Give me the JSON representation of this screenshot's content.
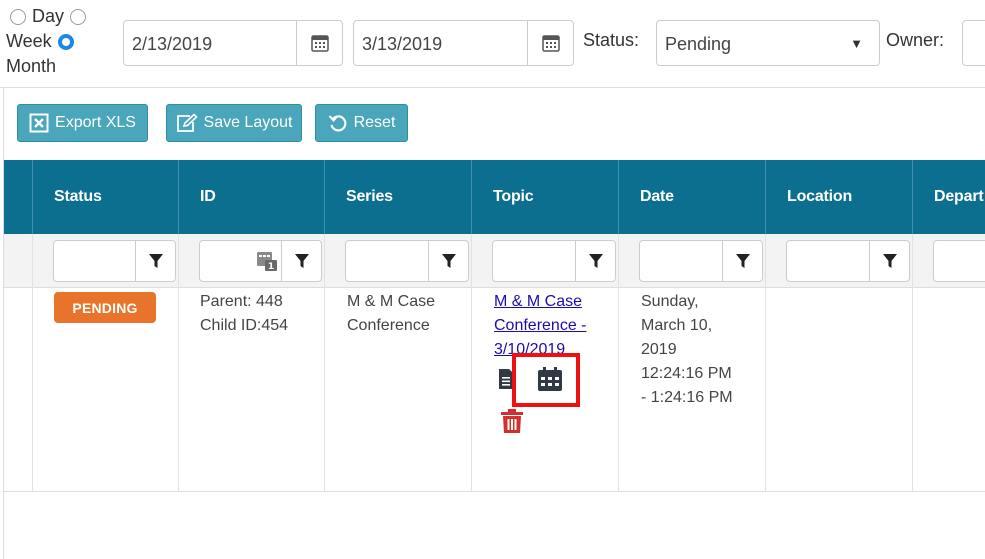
{
  "view_mode": {
    "options": [
      {
        "label": "Day",
        "checked": false
      },
      {
        "label": "Week",
        "checked": true
      },
      {
        "label": "Month",
        "checked": false
      }
    ]
  },
  "date_from": "2/13/2019",
  "date_to": "3/13/2019",
  "status_filter": {
    "label": "Status:",
    "value": "Pending"
  },
  "owner_filter": {
    "label": "Owner:"
  },
  "toolbar": {
    "export_label": "Export XLS",
    "save_layout_label": "Save Layout",
    "reset_label": "Reset"
  },
  "grid": {
    "columns": [
      "Status",
      "ID",
      "Series",
      "Topic",
      "Date",
      "Location",
      "Depart"
    ],
    "rows": [
      {
        "status_badge": "PENDING",
        "id_line1": "Parent: 448",
        "id_line2": "Child ID:454",
        "series_line1": "M & M Case",
        "series_line2": "Conference",
        "topic_line1": "M & M Case",
        "topic_line2": "Conference -",
        "topic_line3": "3/10/2019",
        "date_line1": "Sunday,",
        "date_line2": "March 10,",
        "date_line3": "2019",
        "date_line4": "12:24:16 PM",
        "date_line5": "- 1:24:16 PM"
      }
    ]
  },
  "colors": {
    "header_bg": "#0d6f8f",
    "button_bg": "#4aa6bb",
    "pending_badge": "#e8742c",
    "delete_icon": "#d32f2f",
    "radio_selected": "#1e88e5",
    "highlight_box": "#e11111"
  },
  "icons": [
    "calendar-icon",
    "filter-icon",
    "excel-icon",
    "edit-icon",
    "refresh-icon",
    "document-icon",
    "trash-icon"
  ]
}
